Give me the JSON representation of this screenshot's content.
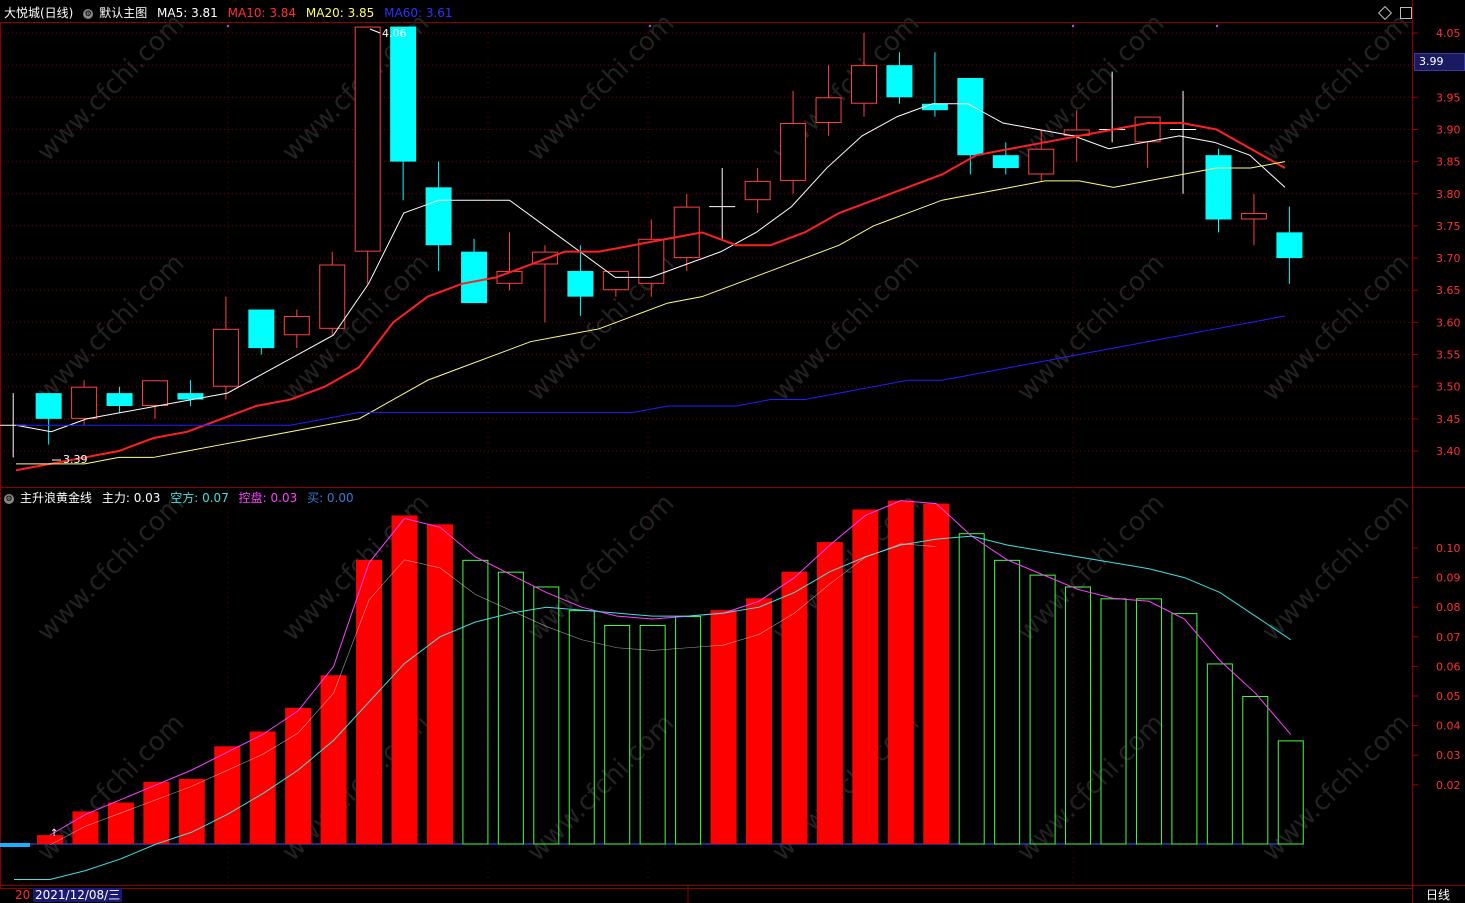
{
  "header": {
    "stock": "大悦城(日线)",
    "main_chart_label": "默认主图",
    "ma5_label": "MA5: 3.81",
    "ma10_label": "MA10: 3.84",
    "ma20_label": "MA20: 3.85",
    "ma60_label": "MA60: 3.61"
  },
  "sub_header": {
    "indicator": "主升浪黄金线",
    "zhuli": "主力: 0.03",
    "kongfang": "空方: 0.07",
    "kongpan": "控盘: 0.03",
    "mai": "买: 0.00"
  },
  "footer": {
    "date": "2021/12/08/三",
    "left_stub": "20",
    "period": "日线"
  },
  "price_box": "3.99",
  "colors": {
    "up": "#ff4040",
    "down": "#00ffff",
    "ma5": "#ffffff",
    "ma10": "#ff2020",
    "ma20": "#ffff80",
    "ma60": "#2020ff",
    "bar_red": "#ff0000",
    "bar_green": "#40ff40",
    "magenta": "#ff40ff",
    "cyan_line": "#40e0e0"
  },
  "chart_data": [
    {
      "type": "candlestick",
      "title": "大悦城(日线)",
      "ylim": [
        3.35,
        4.08
      ],
      "yticks": [
        4.05,
        4.0,
        3.95,
        3.9,
        3.85,
        3.8,
        3.75,
        3.7,
        3.65,
        3.6,
        3.55,
        3.5,
        3.45,
        3.4
      ],
      "annotations": [
        {
          "text": "4.06"
        },
        {
          "text": "3.39"
        }
      ],
      "candles": [
        {
          "o": 3.44,
          "c": 3.44,
          "h": 3.49,
          "l": 3.39
        },
        {
          "o": 3.49,
          "c": 3.45,
          "h": 3.49,
          "l": 3.41
        },
        {
          "o": 3.45,
          "c": 3.5,
          "h": 3.51,
          "l": 3.44
        },
        {
          "o": 3.49,
          "c": 3.47,
          "h": 3.5,
          "l": 3.46
        },
        {
          "o": 3.47,
          "c": 3.51,
          "h": 3.51,
          "l": 3.45
        },
        {
          "o": 3.49,
          "c": 3.48,
          "h": 3.51,
          "l": 3.47
        },
        {
          "o": 3.5,
          "c": 3.59,
          "h": 3.64,
          "l": 3.48
        },
        {
          "o": 3.62,
          "c": 3.56,
          "h": 3.62,
          "l": 3.55
        },
        {
          "o": 3.58,
          "c": 3.61,
          "h": 3.62,
          "l": 3.56
        },
        {
          "o": 3.59,
          "c": 3.69,
          "h": 3.71,
          "l": 3.58
        },
        {
          "o": 3.71,
          "c": 4.06,
          "h": 4.06,
          "l": 3.66
        },
        {
          "o": 4.06,
          "c": 3.85,
          "h": 4.06,
          "l": 3.79
        },
        {
          "o": 3.81,
          "c": 3.72,
          "h": 3.85,
          "l": 3.68
        },
        {
          "o": 3.71,
          "c": 3.63,
          "h": 3.73,
          "l": 3.63
        },
        {
          "o": 3.66,
          "c": 3.68,
          "h": 3.74,
          "l": 3.65
        },
        {
          "o": 3.69,
          "c": 3.71,
          "h": 3.72,
          "l": 3.6
        },
        {
          "o": 3.68,
          "c": 3.64,
          "h": 3.72,
          "l": 3.61
        },
        {
          "o": 3.65,
          "c": 3.68,
          "h": 3.68,
          "l": 3.64
        },
        {
          "o": 3.66,
          "c": 3.73,
          "h": 3.76,
          "l": 3.64
        },
        {
          "o": 3.7,
          "c": 3.78,
          "h": 3.8,
          "l": 3.68
        },
        {
          "o": 3.78,
          "c": 3.78,
          "h": 3.84,
          "l": 3.73
        },
        {
          "o": 3.79,
          "c": 3.82,
          "h": 3.84,
          "l": 3.77
        },
        {
          "o": 3.82,
          "c": 3.91,
          "h": 3.96,
          "l": 3.8
        },
        {
          "o": 3.91,
          "c": 3.95,
          "h": 4.0,
          "l": 3.89
        },
        {
          "o": 3.94,
          "c": 4.0,
          "h": 4.05,
          "l": 3.92
        },
        {
          "o": 4.0,
          "c": 3.95,
          "h": 4.02,
          "l": 3.94
        },
        {
          "o": 3.94,
          "c": 3.93,
          "h": 4.02,
          "l": 3.92
        },
        {
          "o": 3.98,
          "c": 3.86,
          "h": 3.98,
          "l": 3.83
        },
        {
          "o": 3.86,
          "c": 3.84,
          "h": 3.88,
          "l": 3.83
        },
        {
          "o": 3.83,
          "c": 3.87,
          "h": 3.9,
          "l": 3.82
        },
        {
          "o": 3.89,
          "c": 3.9,
          "h": 3.93,
          "l": 3.85
        },
        {
          "o": 3.9,
          "c": 3.9,
          "h": 3.99,
          "l": 3.88
        },
        {
          "o": 3.88,
          "c": 3.92,
          "h": 3.92,
          "l": 3.84
        },
        {
          "o": 3.9,
          "c": 3.9,
          "h": 3.96,
          "l": 3.8
        },
        {
          "o": 3.86,
          "c": 3.76,
          "h": 3.87,
          "l": 3.74
        },
        {
          "o": 3.76,
          "c": 3.77,
          "h": 3.8,
          "l": 3.72
        },
        {
          "o": 3.74,
          "c": 3.7,
          "h": 3.78,
          "l": 3.66
        }
      ],
      "series": [
        {
          "name": "MA5",
          "values": [
            3.44,
            3.43,
            3.45,
            3.46,
            3.47,
            3.48,
            3.49,
            3.52,
            3.55,
            3.58,
            3.66,
            3.77,
            3.79,
            3.79,
            3.79,
            3.75,
            3.71,
            3.67,
            3.67,
            3.69,
            3.71,
            3.74,
            3.78,
            3.84,
            3.89,
            3.92,
            3.94,
            3.94,
            3.91,
            3.9,
            3.89,
            3.87,
            3.88,
            3.89,
            3.88,
            3.86,
            3.81
          ]
        },
        {
          "name": "MA10",
          "values": [
            3.37,
            3.38,
            3.39,
            3.4,
            3.42,
            3.43,
            3.45,
            3.47,
            3.48,
            3.5,
            3.53,
            3.6,
            3.64,
            3.66,
            3.67,
            3.69,
            3.71,
            3.71,
            3.72,
            3.73,
            3.74,
            3.72,
            3.72,
            3.74,
            3.77,
            3.79,
            3.81,
            3.83,
            3.86,
            3.87,
            3.88,
            3.89,
            3.9,
            3.91,
            3.91,
            3.9,
            3.87,
            3.84
          ]
        },
        {
          "name": "MA20",
          "values": [
            3.38,
            3.38,
            3.38,
            3.39,
            3.39,
            3.4,
            3.41,
            3.42,
            3.43,
            3.44,
            3.45,
            3.48,
            3.51,
            3.53,
            3.55,
            3.57,
            3.58,
            3.59,
            3.61,
            3.63,
            3.64,
            3.66,
            3.68,
            3.7,
            3.72,
            3.75,
            3.77,
            3.79,
            3.8,
            3.81,
            3.82,
            3.82,
            3.81,
            3.82,
            3.83,
            3.84,
            3.84,
            3.85
          ]
        },
        {
          "name": "MA60",
          "values": [
            3.44,
            3.44,
            3.44,
            3.44,
            3.44,
            3.44,
            3.44,
            3.44,
            3.44,
            3.45,
            3.46,
            3.46,
            3.46,
            3.46,
            3.46,
            3.46,
            3.46,
            3.46,
            3.46,
            3.47,
            3.47,
            3.47,
            3.48,
            3.48,
            3.49,
            3.5,
            3.51,
            3.51,
            3.52,
            3.53,
            3.54,
            3.55,
            3.56,
            3.57,
            3.58,
            3.59,
            3.6,
            3.61
          ]
        }
      ]
    },
    {
      "type": "bar",
      "title": "主升浪黄金线",
      "ylim": [
        -0.013,
        0.12
      ],
      "yticks": [
        0.1,
        0.09,
        0.08,
        0.07,
        0.06,
        0.05,
        0.04,
        0.03,
        0.02
      ],
      "values": [
        0.003,
        0.011,
        0.014,
        0.021,
        0.022,
        0.033,
        0.038,
        0.046,
        0.057,
        0.096,
        0.111,
        0.108,
        0.096,
        0.092,
        0.087,
        0.079,
        0.074,
        0.074,
        0.077,
        0.079,
        0.083,
        0.092,
        0.102,
        0.113,
        0.116,
        0.115,
        0.105,
        0.096,
        0.091,
        0.087,
        0.083,
        0.083,
        0.078,
        0.061,
        0.05,
        0.035
      ],
      "bar_colors": [
        "red",
        "red",
        "red",
        "red",
        "red",
        "red",
        "red",
        "red",
        "red",
        "red",
        "red",
        "red",
        "green",
        "green",
        "green",
        "green",
        "green",
        "green",
        "green",
        "red",
        "red",
        "red",
        "red",
        "red",
        "red",
        "red",
        "green",
        "green",
        "green",
        "green",
        "green",
        "green",
        "green",
        "green",
        "green",
        "green"
      ],
      "series": [
        {
          "name": "控盘",
          "values": [
            0.003,
            0.01,
            0.015,
            0.02,
            0.025,
            0.031,
            0.037,
            0.045,
            0.06,
            0.095,
            0.11,
            0.107,
            0.097,
            0.091,
            0.085,
            0.08,
            0.077,
            0.076,
            0.077,
            0.078,
            0.082,
            0.09,
            0.101,
            0.111,
            0.116,
            0.115,
            0.104,
            0.096,
            0.091,
            0.086,
            0.083,
            0.082,
            0.076,
            0.062,
            0.051,
            0.037
          ]
        },
        {
          "name": "空方",
          "values": [
            -0.012,
            -0.009,
            -0.005,
            0.0,
            0.004,
            0.01,
            0.017,
            0.025,
            0.035,
            0.048,
            0.061,
            0.07,
            0.075,
            0.078,
            0.08,
            0.079,
            0.078,
            0.077,
            0.077,
            0.078,
            0.08,
            0.085,
            0.092,
            0.097,
            0.101,
            0.103,
            0.104,
            0.101,
            0.099,
            0.097,
            0.095,
            0.093,
            0.09,
            0.085,
            0.077,
            0.069
          ]
        }
      ]
    }
  ]
}
